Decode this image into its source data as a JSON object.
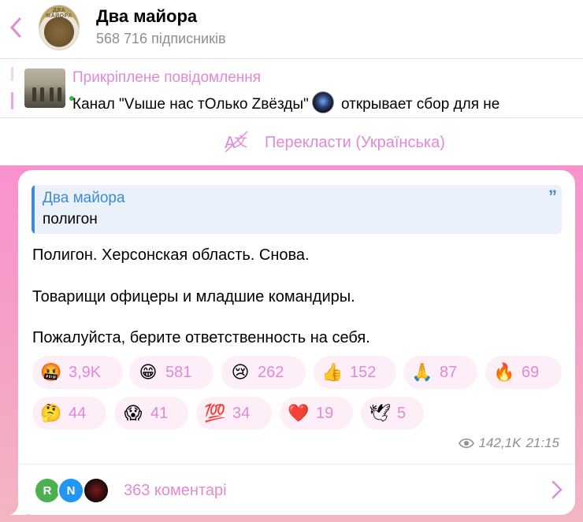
{
  "header": {
    "back_icon": "chevron-left-icon",
    "avatar_text": "ДВА МАЙОРА",
    "title": "Два майора",
    "subtitle": "568 716 підписників"
  },
  "pinned": {
    "title": "Прикріплене повідомлення",
    "text_before": "Канал  \"Vыше нас тОлько Zвёзды\"",
    "text_after": " открывает сбор для не"
  },
  "translate": {
    "icon": "translate-icon",
    "label": "Перекласти (Українська)"
  },
  "message": {
    "quote_author": "Два майора",
    "quote_text": "полигон",
    "quote_icon": "quote-mark-icon",
    "lines": [
      "Полигон. Херсонская область. Снова.",
      "Товарищи офицеры и младшие командиры.",
      "Пожалуйста, берите ответственность на себя."
    ],
    "reactions": [
      {
        "emoji": "🤬",
        "count": "3,9K"
      },
      {
        "emoji": "😁",
        "count": "581"
      },
      {
        "emoji": "😢",
        "count": "262"
      },
      {
        "emoji": "👍",
        "count": "152"
      },
      {
        "emoji": "🙏",
        "count": "87"
      },
      {
        "emoji": "🔥",
        "count": "69"
      },
      {
        "emoji": "🤔",
        "count": "44"
      },
      {
        "emoji": "😱",
        "count": "41"
      },
      {
        "emoji": "💯",
        "count": "34"
      },
      {
        "emoji": "❤️",
        "count": "19"
      },
      {
        "emoji": "🕊",
        "count": "5"
      }
    ],
    "views": "142,1K",
    "time": "21:15"
  },
  "comments": {
    "avatars": [
      "R",
      "N",
      ""
    ],
    "label": "363 коментарі"
  },
  "colors": {
    "accent_pink": "#e089d8",
    "link_blue": "#3e8ad5",
    "avatar_r": "#4caf50",
    "avatar_n": "#2196f3"
  }
}
